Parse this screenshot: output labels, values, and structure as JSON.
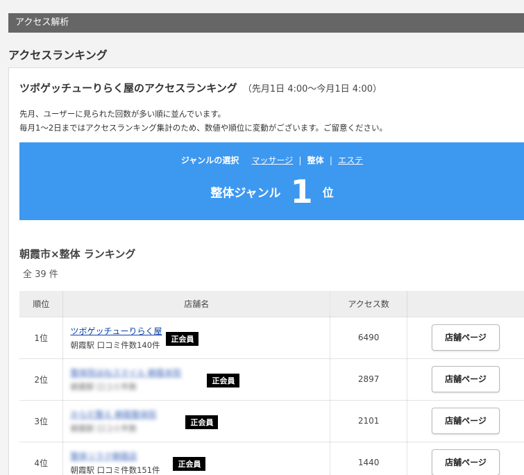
{
  "section_bar": "アクセス解析",
  "page_heading": "アクセスランキング",
  "store": {
    "title": "ツボゲッチューりらく屋のアクセスランキング",
    "period": "（先月1日 4:00〜今月1日 4:00）"
  },
  "description": {
    "line1": "先月、ユーザーに見られた回数が多い順に並んでいます。",
    "line2": "毎月1〜2日まではアクセスランキング集計のため、数値や順位に変動がございます。ご留意ください。"
  },
  "genre_select": {
    "label": "ジャンルの選択",
    "options": [
      "マッサージ",
      "整体",
      "エステ"
    ],
    "separator": "|",
    "current_index": 1
  },
  "rank_result": {
    "genre_name": "整体ジャンル",
    "rank": "1",
    "unit": "位"
  },
  "ranking": {
    "heading": "朝霞市×整体 ランキング",
    "total": "全 39 件",
    "columns": [
      "順位",
      "店舗名",
      "アクセス数",
      ""
    ],
    "button_label": "店舗ページ",
    "badge_label": "正会員",
    "rows": [
      {
        "rank": "1位",
        "name": "ツボゲッチューりらく屋",
        "sub": "朝霞駅 口コミ件数140件",
        "count": "6490",
        "blurred": false
      },
      {
        "rank": "2位",
        "name": "整体院ほねスマイル 朝霞本院",
        "sub": "朝霞駅 口コミ件数",
        "count": "2897",
        "blurred": true
      },
      {
        "rank": "3位",
        "name": "からだ整え 朝霞整体院",
        "sub": "朝霞駅 口コミ件数",
        "count": "2101",
        "blurred": true
      },
      {
        "rank": "4位",
        "name": "整体リラク朝霞店",
        "sub": "朝霞駅 口コミ件数151件",
        "count": "1440",
        "blurred": true
      }
    ]
  },
  "colors": {
    "section_bar": "#666666",
    "accent_blue": "#3d98f0",
    "link": "#0a3ea8",
    "badge": "#000000"
  }
}
